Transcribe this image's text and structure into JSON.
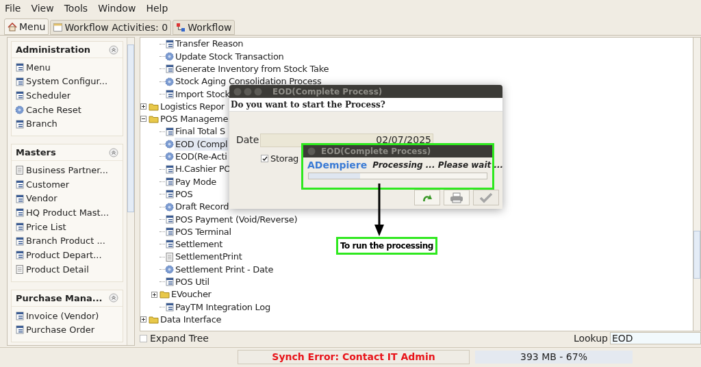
{
  "menu_bar": [
    "File",
    "View",
    "Tools",
    "Window",
    "Help"
  ],
  "tabs": [
    {
      "label": "Menu",
      "selected": true
    },
    {
      "label": "Workflow Activities: 0",
      "selected": false
    },
    {
      "label": "Workflow",
      "selected": false
    }
  ],
  "sidebar": [
    {
      "title": "Administration",
      "items": [
        {
          "label": "Menu",
          "kind": "window"
        },
        {
          "label": "System Configur...",
          "kind": "window"
        },
        {
          "label": "Scheduler",
          "kind": "window"
        },
        {
          "label": "Cache Reset",
          "kind": "process"
        },
        {
          "label": "Branch",
          "kind": "window"
        }
      ]
    },
    {
      "title": "Masters",
      "items": [
        {
          "label": "Business Partner...",
          "kind": "report"
        },
        {
          "label": "Customer",
          "kind": "window"
        },
        {
          "label": "Vendor",
          "kind": "window"
        },
        {
          "label": "HQ Product Mast...",
          "kind": "window"
        },
        {
          "label": "Price List",
          "kind": "window"
        },
        {
          "label": "Branch Product ...",
          "kind": "window"
        },
        {
          "label": "Product Depart...",
          "kind": "window"
        },
        {
          "label": "Product Detail",
          "kind": "report"
        }
      ]
    },
    {
      "title": "Purchase Mana...",
      "items": [
        {
          "label": "Invoice (Vendor)",
          "kind": "window"
        },
        {
          "label": "Purchase Order",
          "kind": "window"
        }
      ]
    }
  ],
  "tree": [
    {
      "children": [
        {
          "label": "Transfer Reason",
          "kind": "window",
          "selected": false
        },
        {
          "label": "Update Stock Transaction",
          "kind": "process",
          "selected": false
        },
        {
          "label": "Generate Inventory from Stock Take",
          "kind": "window",
          "selected": false
        },
        {
          "label": "Stock Aging Consolidation Process",
          "kind": "process",
          "selected": false
        },
        {
          "label": "Import Stock",
          "kind": "window",
          "selected": false
        }
      ]
    },
    {
      "label": "Logistics Repor",
      "kind": "folder",
      "expanded": false,
      "selected": false
    },
    {
      "label": "POS Manageme",
      "kind": "folder",
      "expanded": true,
      "selected": false,
      "children": [
        {
          "label": "Final Total S",
          "kind": "window",
          "selected": false
        },
        {
          "label": "EOD (Compl",
          "kind": "process",
          "selected": true
        },
        {
          "label": "EOD(Re-Acti",
          "kind": "process",
          "selected": false
        },
        {
          "label": "H.Cashier PO",
          "kind": "window",
          "selected": false
        },
        {
          "label": "Pay Mode",
          "kind": "window",
          "selected": false
        },
        {
          "label": "POS",
          "kind": "window",
          "selected": false
        },
        {
          "label": "Draft Record",
          "kind": "process",
          "selected": false
        },
        {
          "label": "POS Payment (Void/Reverse)",
          "kind": "window",
          "selected": false
        },
        {
          "label": "POS Terminal",
          "kind": "window",
          "selected": false
        },
        {
          "label": "Settlement",
          "kind": "window",
          "selected": false
        },
        {
          "label": "SettlementPrint",
          "kind": "report",
          "selected": false
        },
        {
          "label": "Settlement Print - Date",
          "kind": "process",
          "selected": false
        },
        {
          "label": "POS Util",
          "kind": "window",
          "selected": false
        },
        {
          "label": "EVoucher",
          "kind": "folder",
          "expanded": false,
          "selected": false
        },
        {
          "label": "PayTM Integration Log",
          "kind": "window",
          "selected": false
        }
      ]
    },
    {
      "label": "Data Interface",
      "kind": "folder",
      "expanded": false,
      "selected": false
    }
  ],
  "expand_tree": {
    "label": "Expand Tree",
    "checked": false
  },
  "lookup": {
    "label": "Lookup",
    "value": "EOD"
  },
  "status_bar": {
    "message": "Synch Error: Contact IT Admin",
    "memory": "393 MB - 67%"
  },
  "dialog": {
    "title": "EOD(Complete Process)",
    "question": "Do you want to start the Process?",
    "date_label": "Date",
    "date_value": "02/07/2025",
    "storage": {
      "label": "Storag",
      "checked": true
    },
    "buttons": [
      {
        "kind": "next",
        "disabled": false
      },
      {
        "kind": "print",
        "disabled": false
      },
      {
        "kind": "ok",
        "disabled": true
      }
    ]
  },
  "progress_popup": {
    "title": "EOD(Complete Process)",
    "logo": "ADempiere",
    "message": "Processing ... Please wait ...",
    "level": 0.29
  },
  "annotation": {
    "label": "To run the processing"
  }
}
